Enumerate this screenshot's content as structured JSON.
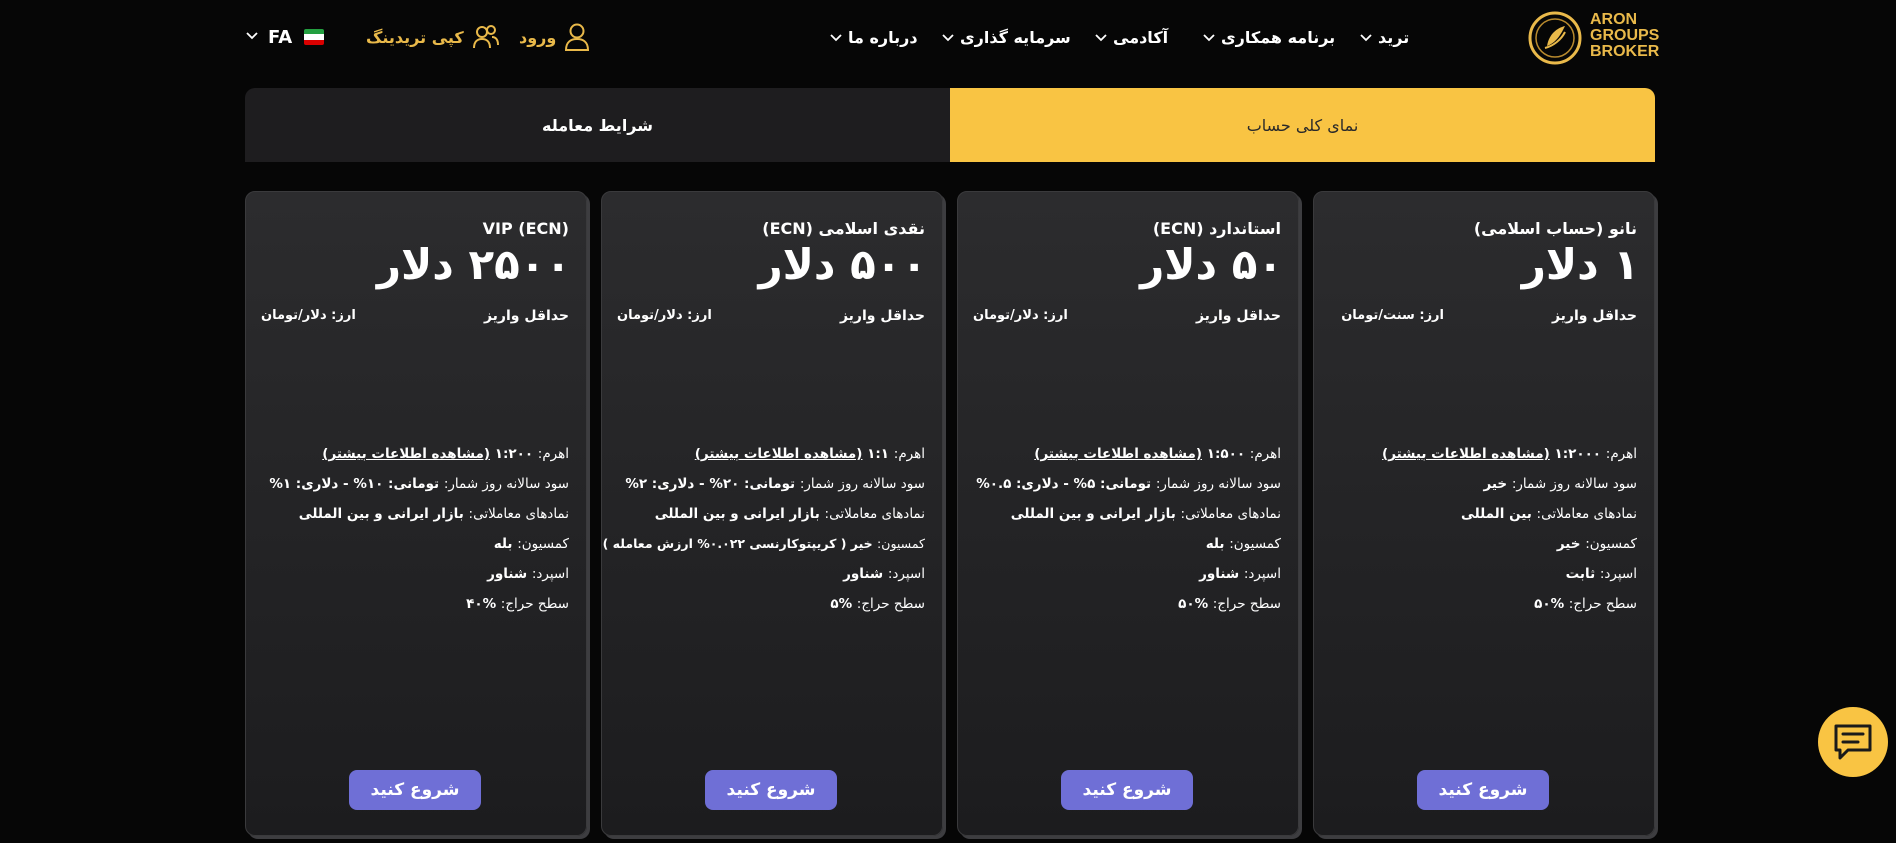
{
  "header": {
    "logo": {
      "line1": "ARON",
      "line2": "GROUPS",
      "line3": "BROKER",
      "icon": "aron-logo-emblem"
    },
    "nav": [
      {
        "label": "ترید"
      },
      {
        "label": "برنامه همکاری"
      },
      {
        "label": "آکادمی"
      },
      {
        "label": "سرمایه گذاری"
      },
      {
        "label": "درباره ما"
      }
    ],
    "login_label": "ورود",
    "copy_trading_label": "کپی تریدینگ",
    "language": "FA",
    "accent_color": "#e9b94a"
  },
  "tabs": {
    "overview_label": "نمای کلی حساب",
    "conditions_label": "شرایط معامله",
    "active_color": "#f9c443"
  },
  "min_deposit_label": "حداقل واریز",
  "start_label": "شروع کنید",
  "more_info_label": "(مشاهده اطلاعات بیشتر)",
  "cards": [
    {
      "title": "نانو (حساب اسلامی)",
      "price": "۱ دلار",
      "currency": "ارز: سنت/تومان",
      "leverage_key": "اهرم:",
      "leverage_val": "۱:۲۰۰۰",
      "profit_key": "سود سالانه روز شمار:",
      "profit_val": "خیر",
      "symbols_key": "نمادهای معاملاتی:",
      "symbols_val": "بین المللی",
      "commission_key": "کمسیون:",
      "commission_val": "خیر",
      "spread_key": "اسپرد:",
      "spread_val": "ثابت",
      "stopout_key": "سطح حراج:",
      "stopout_val": "%۵۰"
    },
    {
      "title": "استاندارد (ECN)",
      "price": "۵۰ دلار",
      "currency": "ارز: دلار/تومان",
      "leverage_key": "اهرم:",
      "leverage_val": "۱:۵۰۰",
      "profit_key": "سود سالانه روز شمار:",
      "profit_val": "تومانی: ۵% - دلاری: ۰.۵%",
      "symbols_key": "نمادهای معاملاتی:",
      "symbols_val": "بازار ایرانی و بین المللی",
      "commission_key": "کمسیون:",
      "commission_val": "بله",
      "spread_key": "اسپرد:",
      "spread_val": "شناور",
      "stopout_key": "سطح حراج:",
      "stopout_val": "%۵۰"
    },
    {
      "title": "نقدی اسلامی (ECN)",
      "price": "۵۰۰ دلار",
      "currency": "ارز: دلار/تومان",
      "leverage_key": "اهرم:",
      "leverage_val": "۱:۱",
      "profit_key": "سود سالانه روز شمار:",
      "profit_val": "تومانی: ۲۰% - دلاری: ۲%",
      "symbols_key": "نمادهای معاملاتی:",
      "symbols_val": "بازار ایرانی و بین المللی",
      "commission_key": "کمسیون:",
      "commission_val": "خیر ( کریپتوکارنسی ۰.۰۲۲% ارزش معامله )",
      "spread_key": "اسپرد:",
      "spread_val": "شناور",
      "stopout_key": "سطح حراج:",
      "stopout_val": "%۵"
    },
    {
      "title": "VIP (ECN)",
      "price": "۲۵۰۰ دلار",
      "currency": "ارز: دلار/تومان",
      "leverage_key": "اهرم:",
      "leverage_val": "۱:۲۰۰",
      "profit_key": "سود سالانه روز شمار:",
      "profit_val": "تومانی: ۱۰% - دلاری: ۱%",
      "symbols_key": "نمادهای معاملاتی:",
      "symbols_val": "بازار ایرانی و بین المللی",
      "commission_key": "کمسیون:",
      "commission_val": "بله",
      "spread_key": "اسپرد:",
      "spread_val": "شناور",
      "stopout_key": "سطح حراج:",
      "stopout_val": "%۴۰"
    }
  ],
  "chat_icon": "chat-bubble-icon",
  "button_color": "#6f6fd6"
}
